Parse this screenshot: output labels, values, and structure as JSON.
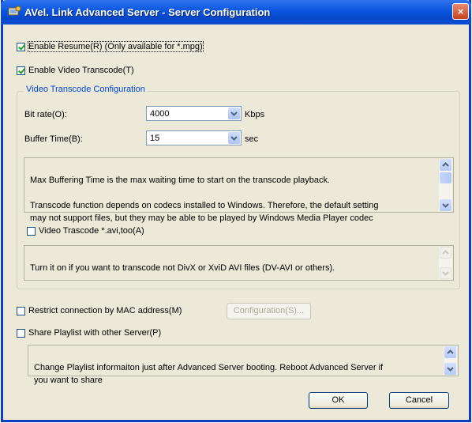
{
  "window": {
    "title": "AVel. Link Advanced Server - Server Configuration",
    "close_label": "×"
  },
  "options": {
    "enable_resume": {
      "label": "Enable Resume(R) (Only available for *.mpg)",
      "checked": true
    },
    "enable_transcode": {
      "label": "Enable Video Transcode(T)",
      "checked": true
    }
  },
  "transcode_group": {
    "title": "Video Transcode Configuration",
    "bitrate": {
      "label": "Bit rate(O):",
      "value": "4000",
      "unit": "Kbps"
    },
    "buffer_time": {
      "label": "Buffer Time(B):",
      "value": "15",
      "unit": "sec"
    },
    "info_text": "Max Buffering Time is the max waiting time to start on the transcode playback.\n\nTranscode function depends on codecs installed to Windows. Therefore, the default setting\nmay not support files, but they may be able to be played by Windows Media Player codec",
    "avi_option": {
      "label": "Video Trascode *.avi,too(A)",
      "checked": false
    },
    "avi_info": "Turn it on if you want to transcode not DivX or XviD AVI files (DV-AVI or others)."
  },
  "mac": {
    "label": "Restrict connection by MAC address(M)",
    "checked": false,
    "config_button": "Configuration(S)..."
  },
  "playlist": {
    "label": "Share Playlist with other Server(P)",
    "checked": false,
    "info": "Change Playlist informaiton just after Advanced Server booting. Reboot Advanced Server if\nyou want to share"
  },
  "buttons": {
    "ok": "OK",
    "cancel": "Cancel"
  },
  "colors": {
    "title_bar": "#0a55e0",
    "dialog_bg": "#ece9d8",
    "group_title": "#0046d5",
    "close": "#c6421e"
  }
}
